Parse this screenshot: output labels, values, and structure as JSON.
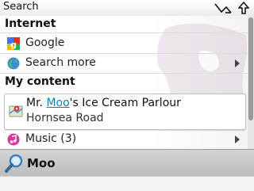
{
  "statusbar": {
    "title": "Search",
    "signal_icon": "signal-icon",
    "up_icon": "up-arrow-icon"
  },
  "internet": {
    "heading": "Internet",
    "items": [
      {
        "label": "Google",
        "icon": "google-icon"
      },
      {
        "label": "Search more",
        "icon": "globe-icon"
      }
    ]
  },
  "my_content": {
    "heading": "My content",
    "result": {
      "name_prefix": "Mr. ",
      "name_highlight": "Moo",
      "name_suffix": "'s Ice Cream Parlour",
      "address": "Hornsea Road",
      "icon": "map-pin-icon"
    },
    "music": {
      "label": "Music (3)",
      "icon": "music-note-icon"
    }
  },
  "search": {
    "value": "Moo",
    "icon": "search-icon"
  },
  "colors": {
    "highlight": "#1a7bb5",
    "searchbar": "#c8c8c8"
  }
}
